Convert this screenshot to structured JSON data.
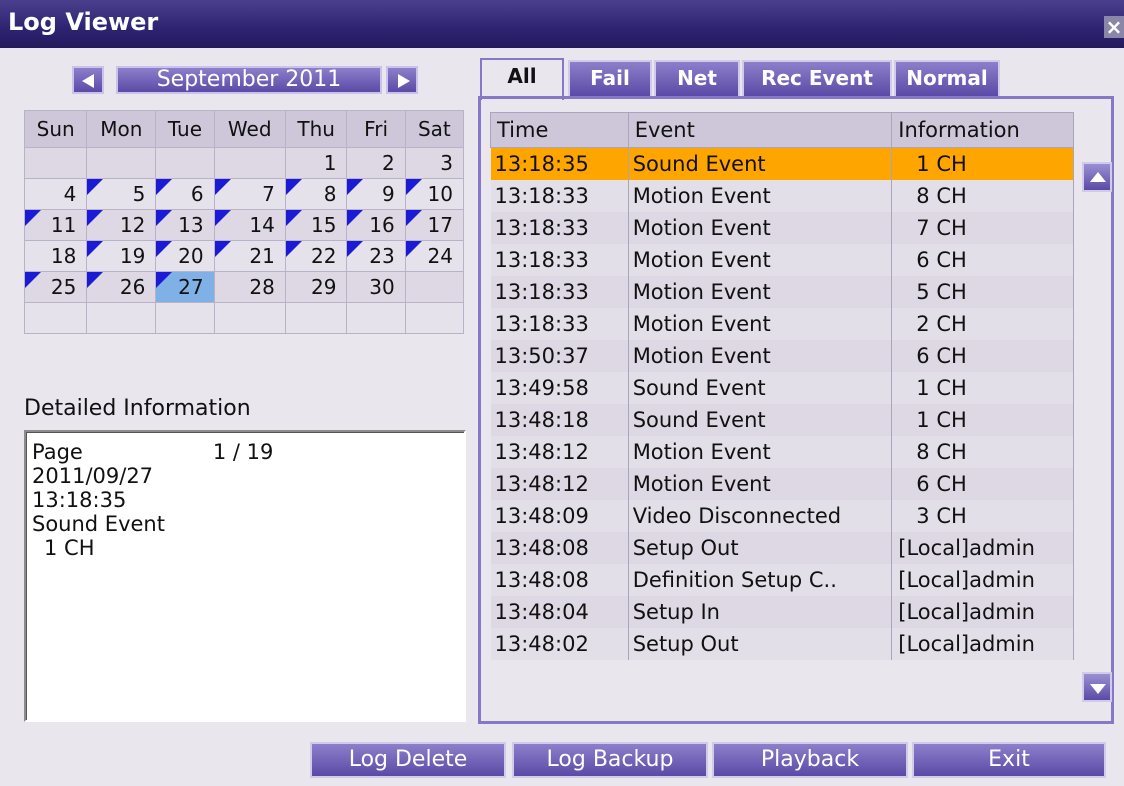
{
  "window": {
    "title": "Log Viewer",
    "close_glyph": "×"
  },
  "calendar": {
    "month_label": "September 2011",
    "weekdays": [
      "Sun",
      "Mon",
      "Tue",
      "Wed",
      "Thu",
      "Fri",
      "Sat"
    ],
    "weeks": [
      [
        "",
        "",
        "",
        "",
        "1",
        "2",
        "3"
      ],
      [
        "4",
        "5",
        "6",
        "7",
        "8",
        "9",
        "10"
      ],
      [
        "11",
        "12",
        "13",
        "14",
        "15",
        "16",
        "17"
      ],
      [
        "18",
        "19",
        "20",
        "21",
        "22",
        "23",
        "24"
      ],
      [
        "25",
        "26",
        "27",
        "28",
        "29",
        "30",
        ""
      ],
      [
        "",
        "",
        "",
        "",
        "",
        "",
        ""
      ]
    ],
    "selected_day": "27",
    "days_with_logs": [
      "5",
      "6",
      "7",
      "8",
      "9",
      "10",
      "11",
      "12",
      "13",
      "14",
      "15",
      "16",
      "17",
      "19",
      "20",
      "21",
      "22",
      "23",
      "24",
      "25",
      "26",
      "27"
    ],
    "flag_color": "#1b1bd6",
    "selected_color": "#7fb0e6"
  },
  "detail": {
    "title": "Detailed Information",
    "page_label": "Page",
    "page_value": "1 / 19",
    "date": "2011/09/27",
    "time": "13:18:35",
    "event": "Sound Event",
    "info": "1 CH"
  },
  "tabs": [
    "All",
    "Fail",
    "Net",
    "Rec Event",
    "Normal"
  ],
  "active_tab": "All",
  "log_table": {
    "headers": [
      "Time",
      "Event",
      "Information"
    ],
    "rows": [
      [
        "13:18:35",
        "Sound Event",
        "1 CH"
      ],
      [
        "13:18:33",
        "Motion Event",
        "8 CH"
      ],
      [
        "13:18:33",
        "Motion Event",
        "7 CH"
      ],
      [
        "13:18:33",
        "Motion Event",
        "6 CH"
      ],
      [
        "13:18:33",
        "Motion Event",
        "5 CH"
      ],
      [
        "13:18:33",
        "Motion Event",
        "2 CH"
      ],
      [
        "13:50:37",
        "Motion Event",
        "6 CH"
      ],
      [
        "13:49:58",
        "Sound Event",
        "1 CH"
      ],
      [
        "13:48:18",
        "Sound Event",
        "1 CH"
      ],
      [
        "13:48:12",
        "Motion Event",
        "8 CH"
      ],
      [
        "13:48:12",
        "Motion Event",
        "6 CH"
      ],
      [
        "13:48:09",
        "Video Disconnected",
        "3 CH"
      ],
      [
        "13:48:08",
        "Setup Out",
        "[Local]admin"
      ],
      [
        "13:48:08",
        "Definition Setup C..",
        "[Local]admin"
      ],
      [
        "13:48:04",
        "Setup In",
        "[Local]admin"
      ],
      [
        "13:48:02",
        "Setup Out",
        "[Local]admin"
      ]
    ],
    "selected_row": 0,
    "selected_color": "#ffa500"
  },
  "buttons": {
    "log_delete": "Log Delete",
    "log_backup": "Log Backup",
    "playback": "Playback",
    "exit": "Exit"
  },
  "colors": {
    "accent": "#5b4aa6",
    "title_bar": "#2d2370"
  }
}
